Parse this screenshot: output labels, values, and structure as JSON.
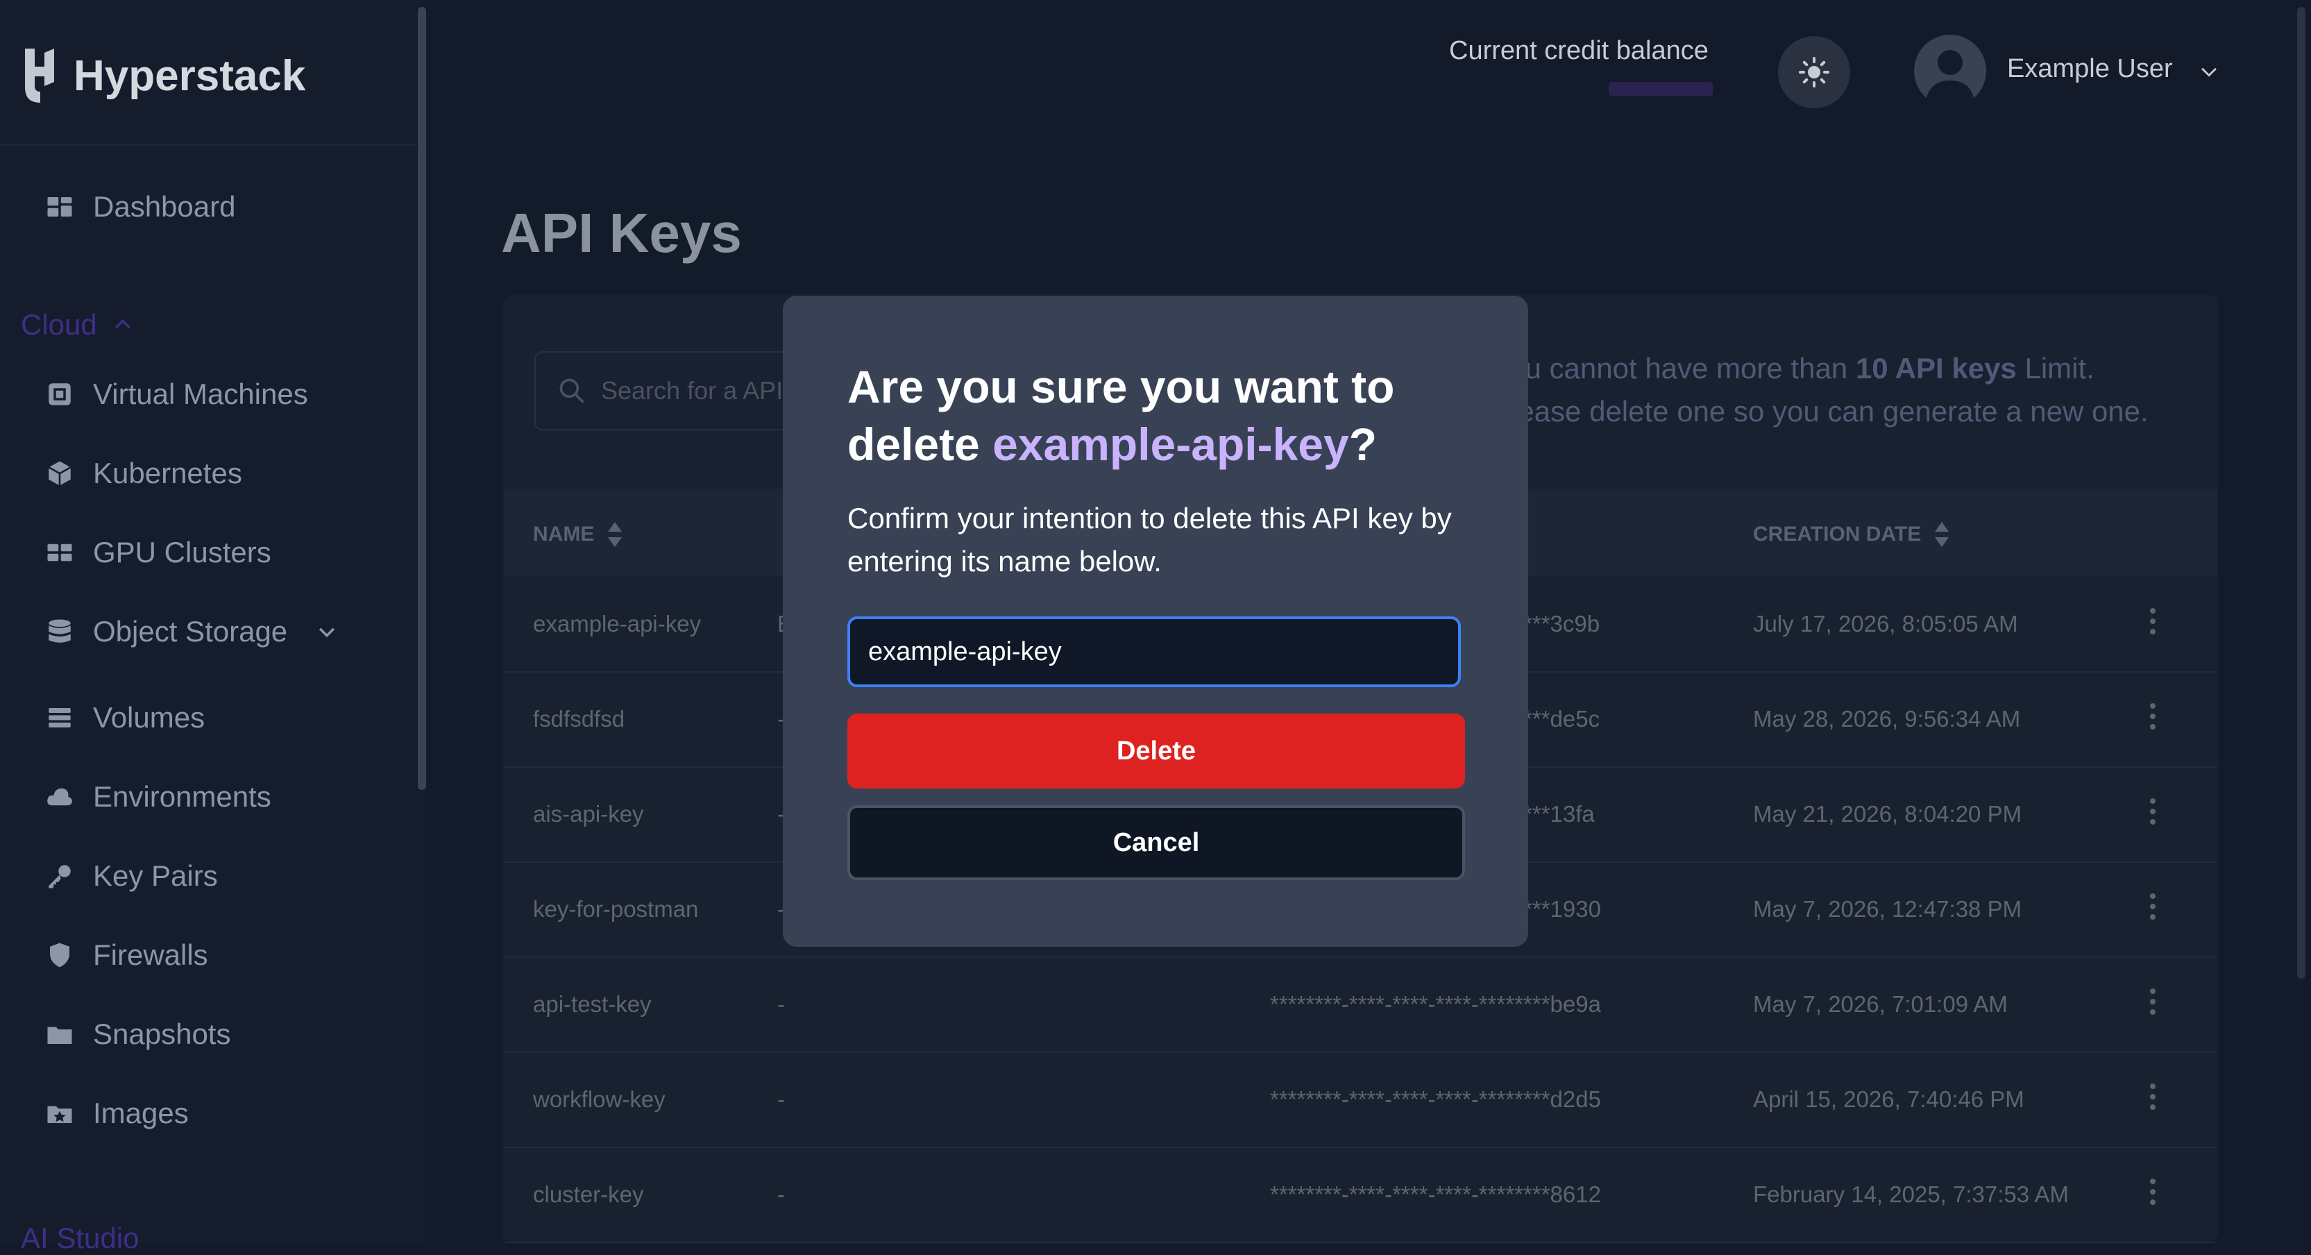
{
  "brand": {
    "name": "Hyperstack"
  },
  "header": {
    "credit_label": "Current credit balance",
    "user_name": "Example User"
  },
  "sidebar": {
    "dashboard": "Dashboard",
    "section_cloud": "Cloud",
    "items": [
      {
        "label": "Virtual Machines",
        "icon": "vm-icon"
      },
      {
        "label": "Kubernetes",
        "icon": "cube-icon"
      },
      {
        "label": "GPU Clusters",
        "icon": "cluster-icon"
      },
      {
        "label": "Object Storage",
        "icon": "storage-icon"
      },
      {
        "label": "Volumes",
        "icon": "volumes-icon"
      },
      {
        "label": "Environments",
        "icon": "cloud-icon"
      },
      {
        "label": "Key Pairs",
        "icon": "key-icon"
      },
      {
        "label": "Firewalls",
        "icon": "shield-icon"
      },
      {
        "label": "Snapshots",
        "icon": "snapshot-icon"
      },
      {
        "label": "Images",
        "icon": "images-icon"
      }
    ],
    "section_ai": "AI Studio"
  },
  "page": {
    "title": "API Keys",
    "search_placeholder": "Search for a API key",
    "notice_line1_pre": "You cannot have more than ",
    "notice_bold": "10 API keys",
    "notice_line1_post": " Limit.",
    "notice_line2": "Please delete one so you can generate a new one."
  },
  "table": {
    "headers": {
      "name": "NAME",
      "created": "CREATION DATE"
    },
    "rows": [
      {
        "name": "example-api-key",
        "desc": "E",
        "key": "********-****-****-****-********3c9b",
        "date": "July 17, 2026, 8:05:05 AM"
      },
      {
        "name": "fsdfsdfsd",
        "desc": "-",
        "key": "********-****-****-****-********de5c",
        "date": "May 28, 2026, 9:56:34 AM"
      },
      {
        "name": "ais-api-key",
        "desc": "-",
        "key": "********-****-****-****-********13fa",
        "date": "May 21, 2026, 8:04:20 PM"
      },
      {
        "name": "key-for-postman",
        "desc": "-",
        "key": "********-****-****-****-********1930",
        "date": "May 7, 2026, 12:47:38 PM"
      },
      {
        "name": "api-test-key",
        "desc": "-",
        "key": "********-****-****-****-********be9a",
        "date": "May 7, 2026, 7:01:09 AM"
      },
      {
        "name": "workflow-key",
        "desc": "-",
        "key": "********-****-****-****-********d2d5",
        "date": "April 15, 2026, 7:40:46 PM"
      },
      {
        "name": "cluster-key",
        "desc": "-",
        "key": "********-****-****-****-********8612",
        "date": "February 14, 2025, 7:37:53 AM"
      }
    ]
  },
  "modal": {
    "title_pre": "Are you sure you want to delete ",
    "title_name": "example-api-key",
    "title_post": "?",
    "description": "Confirm your intention to delete this API key by entering its name below.",
    "input_value": "example-api-key",
    "delete_label": "Delete",
    "cancel_label": "Cancel"
  },
  "colors": {
    "accent": "#c9b3ff",
    "danger": "#de2222",
    "focus": "#3b82f6"
  }
}
